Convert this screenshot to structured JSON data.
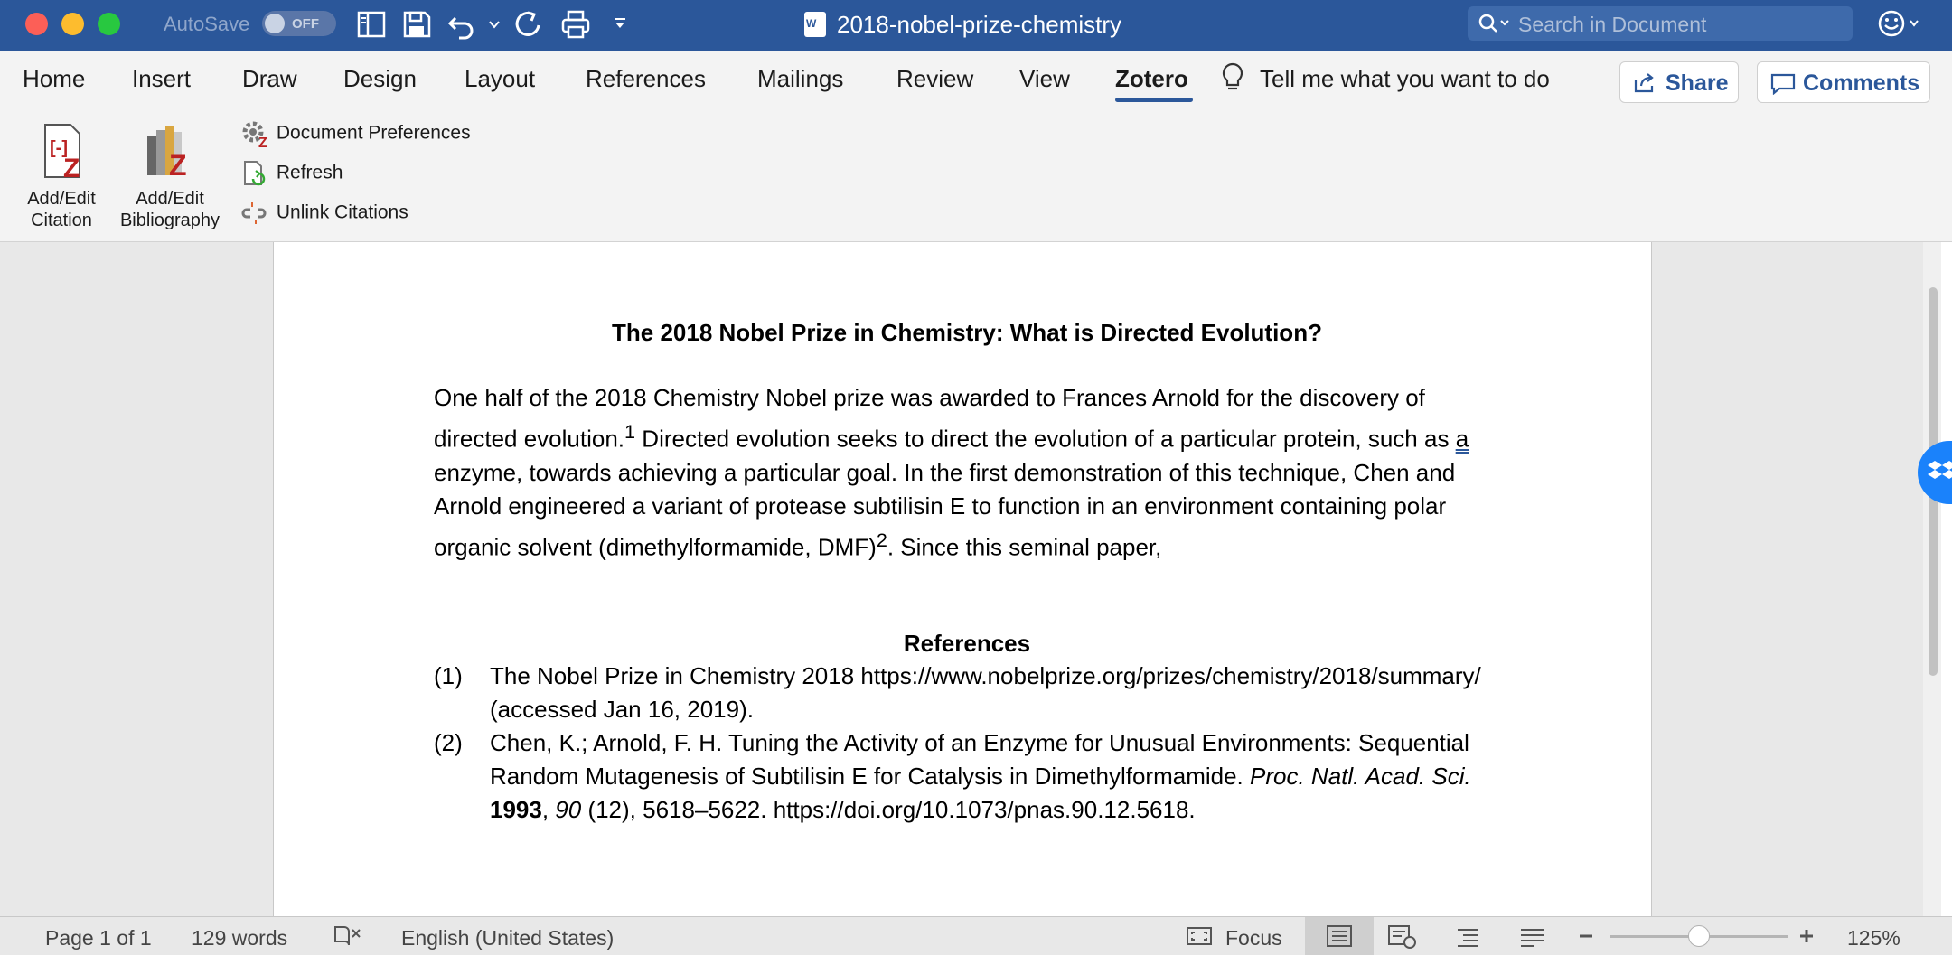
{
  "titlebar": {
    "autosave_label": "AutoSave",
    "autosave_state": "OFF",
    "doc_title": "2018-nobel-prize-chemistry",
    "search_placeholder": "Search in Document",
    "bar_color": "#2b579a"
  },
  "menu": {
    "tabs": [
      "Home",
      "Insert",
      "Draw",
      "Design",
      "Layout",
      "References",
      "Mailings",
      "Review",
      "View",
      "Zotero"
    ],
    "active_tab": "Zotero",
    "tell_me": "Tell me what you want to do",
    "share_label": "Share",
    "comments_label": "Comments"
  },
  "ribbon": {
    "add_edit_citation": [
      "Add/Edit",
      "Citation"
    ],
    "add_edit_bibliography": [
      "Add/Edit",
      "Bibliography"
    ],
    "document_preferences": "Document Preferences",
    "refresh": "Refresh",
    "unlink_citations": "Unlink Citations"
  },
  "document": {
    "heading": "The 2018 Nobel Prize in Chemistry: What is Directed Evolution?",
    "para_1a": "One half of the 2018 Chemistry Nobel prize was awarded to Frances Arnold for the discovery of directed evolution.",
    "sup_1": "1",
    "para_1b": " Directed evolution seeks to direct the evolution of a particular protein, such as ",
    "para_1c": "a",
    "para_1d": " enzyme, towards achieving a particular goal. In the first demonstration of this technique, Chen and Arnold engineered a variant of protease subtilisin E to function in an environment containing polar organic solvent (dimethylformamide, DMF)",
    "sup_2": "2",
    "para_1e": ". Since this seminal paper,",
    "refs_heading": "References",
    "ref1_num": "(1)",
    "ref1_text": "The Nobel Prize in Chemistry 2018 https://www.nobelprize.org/prizes/chemistry/2018/summary/ (accessed Jan 16, 2019).",
    "ref2_num": "(2)",
    "ref2_a": "Chen, K.; Arnold, F. H. Tuning the Activity of an Enzyme for Unusual Environments: Sequential Random Mutagenesis of Subtilisin E for Catalysis in Dimethylformamide. ",
    "ref2_journal": "Proc. Natl. Acad. Sci.",
    "ref2_sp": " ",
    "ref2_year": "1993",
    "ref2_comma": ", ",
    "ref2_vol": "90",
    "ref2_rest": " (12), 5618–5622. https://doi.org/10.1073/pnas.90.12.5618."
  },
  "status": {
    "page": "Page 1 of 1",
    "words": "129 words",
    "language": "English (United States)",
    "focus": "Focus",
    "zoom": "125%",
    "zoom_level_percent": 125
  }
}
